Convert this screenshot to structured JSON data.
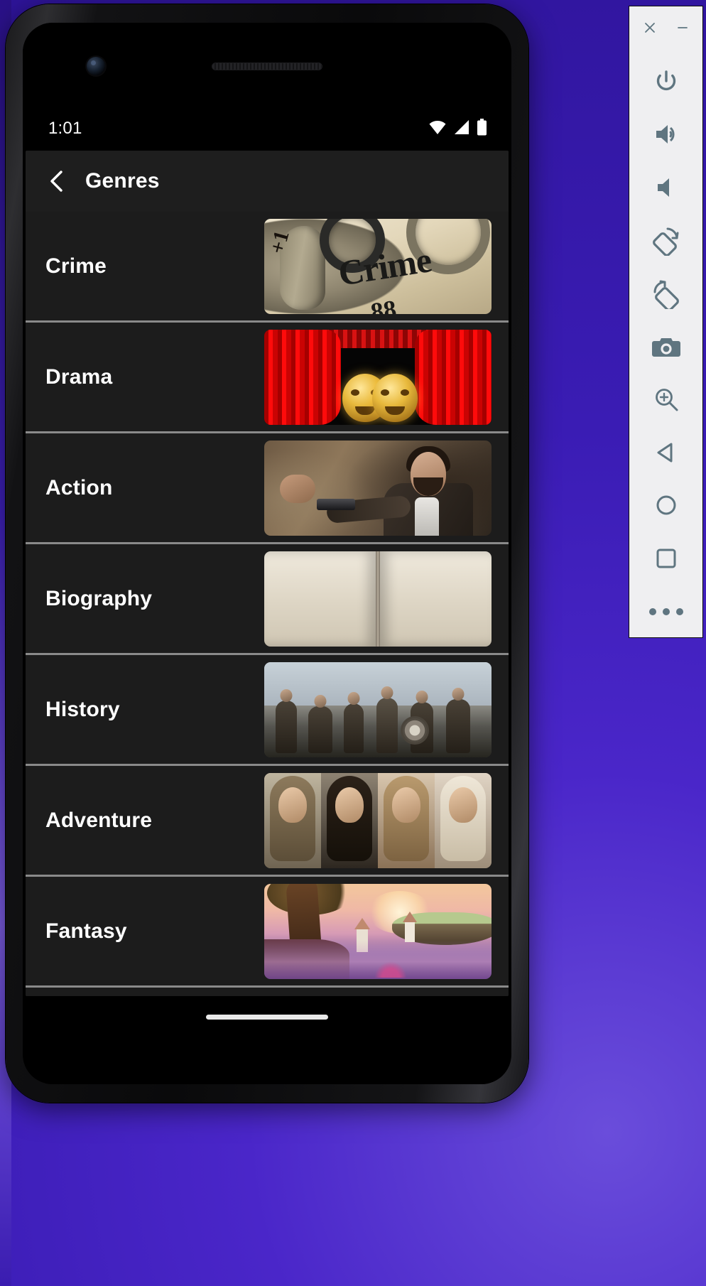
{
  "device": {
    "camera_icon": "front-camera",
    "speaker_icon": "earpiece-speaker"
  },
  "status_bar": {
    "time": "1:01",
    "icons": [
      {
        "name": "wifi-icon",
        "label": "Wi-Fi"
      },
      {
        "name": "cellular-signal-icon",
        "label": "Signal"
      },
      {
        "name": "battery-icon",
        "label": "Battery"
      }
    ]
  },
  "app_bar": {
    "back_icon": "back-chevron-icon",
    "title": "Genres"
  },
  "genres": [
    {
      "name": "Crime",
      "thumb_alt": "handcuffs-on-newspaper",
      "art": "art-crime"
    },
    {
      "name": "Drama",
      "thumb_alt": "theatre-masks-red-curtain",
      "art": "art-drama"
    },
    {
      "name": "Action",
      "thumb_alt": "man-aiming-pistol",
      "art": "art-action"
    },
    {
      "name": "Biography",
      "thumb_alt": "open-book-pages",
      "art": "art-bio"
    },
    {
      "name": "History",
      "thumb_alt": "vikings-walking-in-snow",
      "art": "art-hist"
    },
    {
      "name": "Adventure",
      "thumb_alt": "four-warrior-portraits",
      "art": "art-adv"
    },
    {
      "name": "Fantasy",
      "thumb_alt": "floating-fantasy-island",
      "art": "art-fant"
    }
  ],
  "gesture_bar": {
    "handle": "home-gesture-pill"
  },
  "emulator_toolbar": {
    "window_buttons": [
      {
        "name": "close-window-button",
        "glyph": "×"
      },
      {
        "name": "minimize-window-button",
        "glyph": "—"
      }
    ],
    "buttons": [
      {
        "name": "power-button",
        "label": "Power"
      },
      {
        "name": "volume-up-button",
        "label": "Volume Up"
      },
      {
        "name": "volume-down-button",
        "label": "Volume Down"
      },
      {
        "name": "rotate-left-button",
        "label": "Rotate Left"
      },
      {
        "name": "rotate-right-button",
        "label": "Rotate Right"
      },
      {
        "name": "screenshot-button",
        "label": "Take Screenshot"
      },
      {
        "name": "zoom-button",
        "label": "Enter Zoom Mode"
      },
      {
        "name": "back-button",
        "label": "Back"
      },
      {
        "name": "home-button",
        "label": "Home"
      },
      {
        "name": "overview-button",
        "label": "Overview"
      },
      {
        "name": "more-button",
        "label": "More"
      }
    ]
  },
  "colors": {
    "desktop_background": "#3b1fb8",
    "app_background": "#121212",
    "row_background": "#1c1c1c",
    "app_bar_background": "#1e1e1e",
    "divider": "#8a8a8a",
    "text_primary": "#ffffff",
    "toolbar_background": "#efeff1",
    "toolbar_icon": "#5f7580"
  }
}
